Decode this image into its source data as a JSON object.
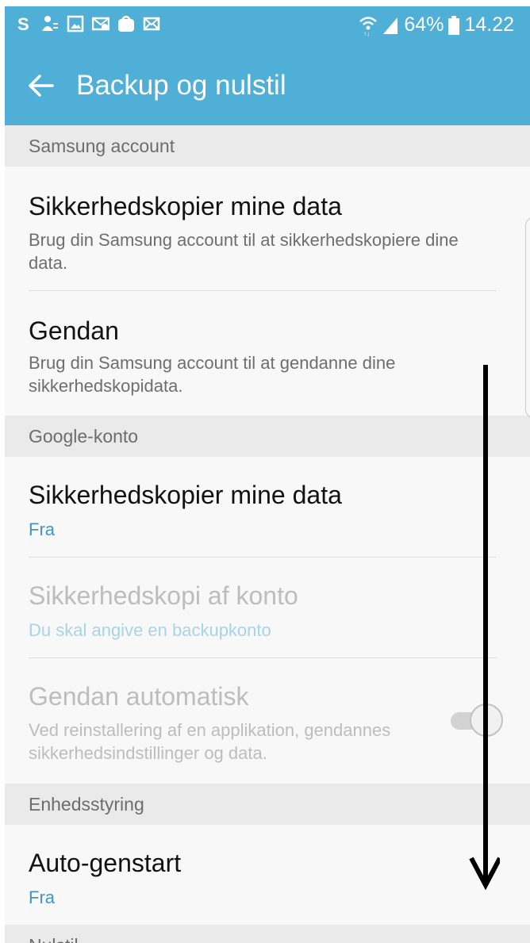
{
  "status_bar": {
    "battery": "64%",
    "time": "14.22",
    "left_icons": [
      "skype-icon",
      "accessibility-icon",
      "gallery-icon",
      "settings-mail-icon",
      "samsung-store-icon",
      "email-icon"
    ],
    "right_icons": [
      "wifi-icon",
      "signal-icon",
      "battery-icon"
    ]
  },
  "app_bar": {
    "title": "Backup og nulstil"
  },
  "sections": {
    "samsung": {
      "header": "Samsung account"
    },
    "google": {
      "header": "Google-konto"
    },
    "device": {
      "header": "Enhedsstyring"
    },
    "reset": {
      "header": "Nulstil"
    }
  },
  "items": {
    "samsung_backup": {
      "title": "Sikkerhedskopier mine data",
      "subtitle": "Brug din Samsung account til at sikkerhedskopiere dine data."
    },
    "samsung_restore": {
      "title": "Gendan",
      "subtitle": "Brug din Samsung account til at gendanne dine sikkerhedskopidata."
    },
    "google_backup": {
      "title": "Sikkerhedskopier mine data",
      "subtitle": "Fra"
    },
    "backup_account": {
      "title": "Sikkerhedskopi af konto",
      "subtitle": "Du skal angive en backupkonto"
    },
    "auto_restore": {
      "title": "Gendan automatisk",
      "subtitle": "Ved reinstallering af en applikation, gendannes sikkerhedsindstillinger og data.",
      "toggle_on": true
    },
    "auto_restart": {
      "title": "Auto-genstart",
      "subtitle": "Fra"
    }
  },
  "colors": {
    "accent": "#4fafd6",
    "link": "#3f97c3",
    "section_bg": "#eaeaea"
  }
}
